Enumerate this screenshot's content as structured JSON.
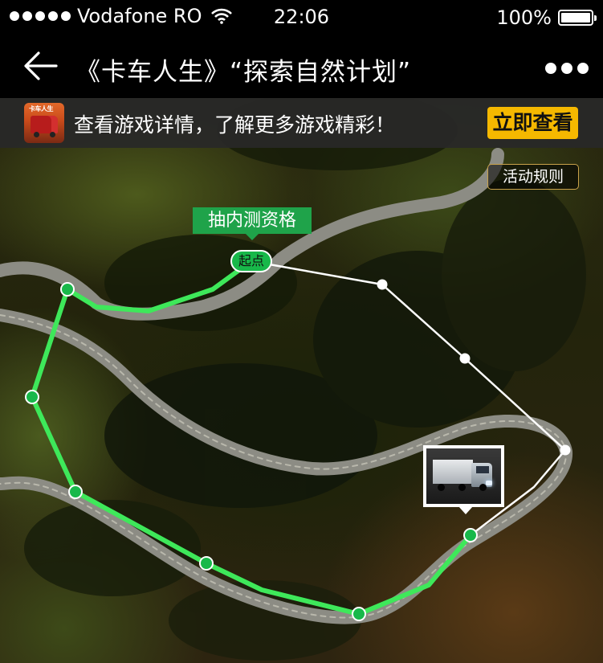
{
  "status_bar": {
    "carrier": "Vodafone RO",
    "time": "22:06",
    "battery": "100%"
  },
  "nav": {
    "title": "《卡车人生》“探索自然计划”"
  },
  "promo": {
    "text": "查看游戏详情，了解更多游戏精彩！",
    "button_label": "立即查看",
    "icon_text": "卡车人生"
  },
  "map": {
    "rules_label": "活动规则",
    "lottery_tag": "抽内测资格",
    "start_label": "起点"
  },
  "colors": {
    "accent_green": "#1fa34a",
    "route_green": "#3ee85a",
    "button_yellow": "#f5b800",
    "rules_border": "#c9a24a"
  }
}
